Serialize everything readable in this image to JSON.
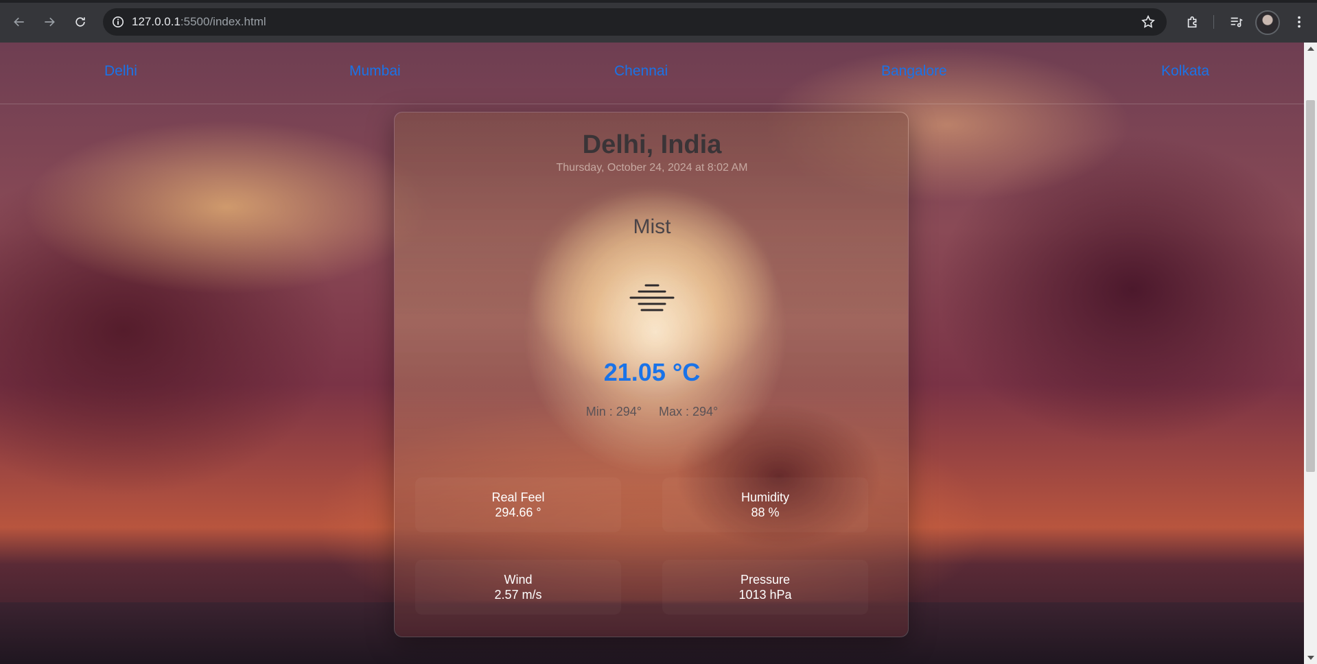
{
  "browser": {
    "url_host": "127.0.0.1",
    "url_rest": ":5500/index.html"
  },
  "cities": [
    "Delhi",
    "Mumbai",
    "Chennai",
    "Bangalore",
    "Kolkata"
  ],
  "weather": {
    "location": "Delhi, India",
    "datetime": "Thursday, October 24, 2024 at 8:02 AM",
    "condition": "Mist",
    "icon": "mist-icon",
    "temperature": "21.05 °C",
    "min": "Min : 294°",
    "max": "Max : 294°",
    "stats": [
      {
        "label": "Real Feel",
        "value": "294.66 °"
      },
      {
        "label": "Humidity",
        "value": "88 %"
      },
      {
        "label": "Wind",
        "value": "2.57 m/s"
      },
      {
        "label": "Pressure",
        "value": "1013 hPa"
      }
    ]
  },
  "colors": {
    "accent": "#1a73e8"
  }
}
